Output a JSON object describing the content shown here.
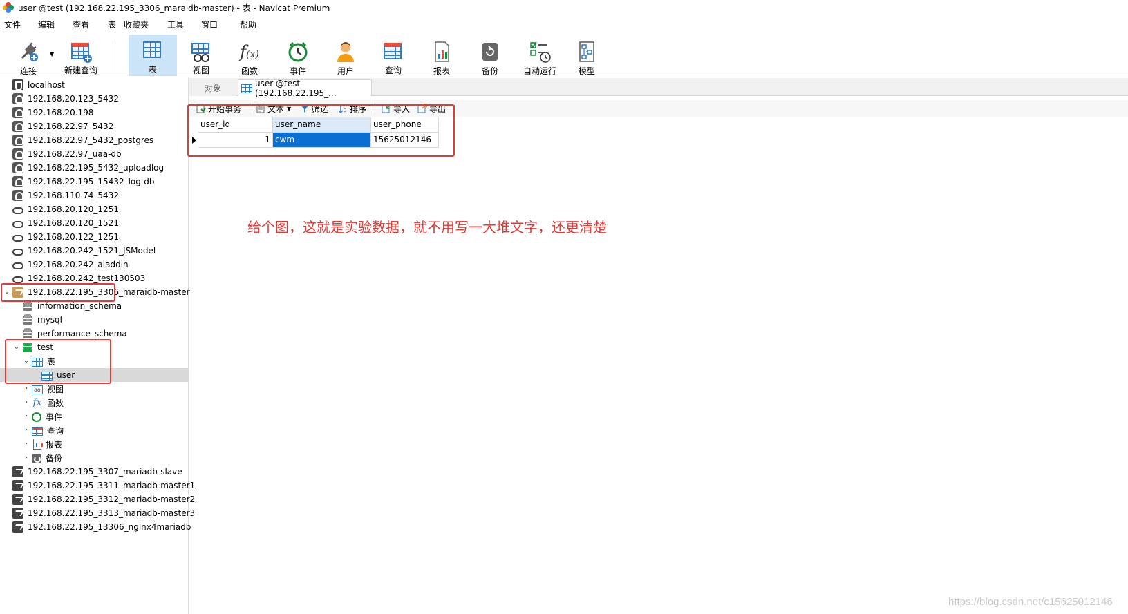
{
  "window": {
    "title": "user @test (192.168.22.195_3306_maraidb-master) - 表 - Navicat Premium"
  },
  "menu": [
    "文件",
    "编辑",
    "查看",
    "表",
    "收藏夹",
    "工具",
    "窗口",
    "帮助"
  ],
  "toolbar": {
    "connect": "连接",
    "new_query": "新建查询",
    "table": "表",
    "view": "视图",
    "function": "函数",
    "event": "事件",
    "user": "用户",
    "query": "查询",
    "report": "报表",
    "backup": "备份",
    "auto_run": "自动运行",
    "model": "模型"
  },
  "sidebar": {
    "connections": [
      "localhost",
      "192.168.20.123_5432",
      "192.168.20.198",
      "192.168.22.97_5432",
      "192.168.22.97_5432_postgres",
      "192.168.22.97_uaa-db",
      "192.168.22.195_5432_uploadlog",
      "192.168.22.195_15432_log-db",
      "192.168.110.74_5432",
      "192.168.20.120_1251",
      "192.168.20.120_1521",
      "192.168.20.122_1251",
      "192.168.20.242_1521_JSModel",
      "192.168.20.242_aladdin",
      "192.168.20.242_test130503",
      "192.168.22.195_3306_maraidb-master"
    ],
    "databases": [
      "information_schema",
      "mysql",
      "performance_schema",
      "test"
    ],
    "test_children": {
      "tables": "表",
      "user_table": "user",
      "views": "视图",
      "functions": "函数",
      "events": "事件",
      "queries": "查询",
      "reports": "报表",
      "backups": "备份"
    },
    "more_connections": [
      "192.168.22.195_3307_mariadb-slave",
      "192.168.22.195_3311_mariadb-master1",
      "192.168.22.195_3312_mariadb-master2",
      "192.168.22.195_3313_mariadb-master3",
      "192.168.22.195_13306_nginx4mariadb"
    ]
  },
  "tabs": {
    "objects": "对象",
    "active": "user @test (192.168.22.195_..."
  },
  "content_toolbar": {
    "begin_transaction": "开始事务",
    "text": "文本",
    "filter": "筛选",
    "sort": "排序",
    "import": "导入",
    "export": "导出"
  },
  "table": {
    "columns": [
      "user_id",
      "user_name",
      "user_phone"
    ],
    "rows": [
      [
        "1",
        "cwm",
        "15625012146"
      ]
    ]
  },
  "annotation": "给个图，这就是实验数据，就不用写一大堆文字，还更清楚",
  "watermark": "https://blog.csdn.net/c15625012146",
  "colors": {
    "annotation_red": "#e53935",
    "selection_blue": "#0a6fd1",
    "icon_blue": "#2f7bc5"
  }
}
